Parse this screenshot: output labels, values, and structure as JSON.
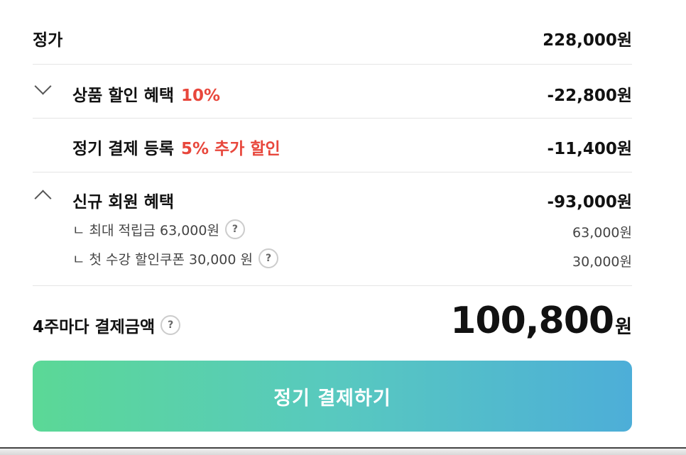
{
  "regular_price": {
    "label": "정가",
    "amount": "228,000원"
  },
  "product_discount": {
    "label": "상품 할인 혜택",
    "rate": "10%",
    "amount": "-22,800원"
  },
  "subscription": {
    "label": "정기 결제 등록",
    "extra": "5% 추가 할인",
    "amount": "-11,400원"
  },
  "new_member": {
    "label": "신규 회원 혜택",
    "amount": "-93,000원",
    "items": [
      {
        "label": "ㄴ 최대 적립금 63,000원",
        "amount": "63,000원"
      },
      {
        "label": "ㄴ 첫 수강 할인쿠폰 30,000 원",
        "amount": "30,000원"
      }
    ]
  },
  "total": {
    "label": "4주마다 결제금액",
    "number": "100,800",
    "unit": "원"
  },
  "cta": {
    "label": "정기 결제하기"
  },
  "help_symbol": "?",
  "colors": {
    "accent": "#e8473c",
    "gradient_start": "#5bd896",
    "gradient_end": "#4daed8"
  }
}
